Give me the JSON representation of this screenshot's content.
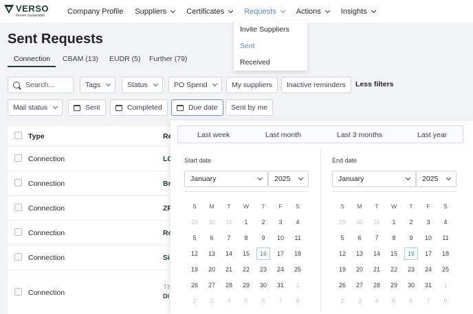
{
  "brand": {
    "name": "VERSO",
    "tagline": "forever sustainabili"
  },
  "nav": [
    {
      "label": "Company Profile",
      "chevron": false,
      "active": false,
      "name": "nav-company-profile"
    },
    {
      "label": "Suppliers",
      "chevron": true,
      "active": false,
      "name": "nav-suppliers"
    },
    {
      "label": "Certificates",
      "chevron": true,
      "active": false,
      "name": "nav-certificates"
    },
    {
      "label": "Requests",
      "chevron": true,
      "active": true,
      "name": "nav-requests"
    },
    {
      "label": "Actions",
      "chevron": true,
      "active": false,
      "name": "nav-actions"
    },
    {
      "label": "Insights",
      "chevron": true,
      "active": false,
      "name": "nav-insights"
    }
  ],
  "requests_menu": [
    {
      "label": "Invite Suppliers",
      "active": false
    },
    {
      "label": "Sent",
      "active": true
    },
    {
      "label": "Received",
      "active": false
    }
  ],
  "page": {
    "title": "Sent Requests"
  },
  "tabs": [
    {
      "label": "Connection",
      "active": true
    },
    {
      "label": "CBAM (13)",
      "active": false
    },
    {
      "label": "EUDR (5)",
      "active": false
    },
    {
      "label": "Further (79)",
      "active": false
    }
  ],
  "filters": {
    "search_placeholder": "Search...",
    "tags": "Tags",
    "status": "Status",
    "po_spend": "PO Spend",
    "my_suppliers": "My suppliers",
    "inactive_reminders": "Inactive reminders",
    "less_filters": "Less filters",
    "mail_status": "Mail status",
    "sent": "Sent",
    "completed": "Completed",
    "due_date": "Due date",
    "sent_by_me": "Sent by me"
  },
  "table": {
    "col_type": "Type",
    "col_recipient": "Re",
    "rows": [
      {
        "type": "Connection",
        "name": "LG"
      },
      {
        "type": "Connection",
        "name": "Br"
      },
      {
        "type": "Connection",
        "name": "ZF"
      },
      {
        "type": "Connection",
        "name": "Ro"
      },
      {
        "type": "Connection",
        "name": "Si"
      },
      {
        "type": "Connection",
        "name": "Th",
        "sub": "Di"
      }
    ]
  },
  "date_picker": {
    "presets": [
      "Last week",
      "Last month",
      "Last 3 months",
      "Last year"
    ],
    "weekdays": [
      "S",
      "M",
      "T",
      "W",
      "T",
      "F",
      "S"
    ],
    "start": {
      "label": "Start date",
      "month": "January",
      "year": "2025"
    },
    "end": {
      "label": "End date",
      "month": "January",
      "year": "2025"
    },
    "weeks": [
      [
        "29",
        "30",
        "31",
        "1",
        "2",
        "3",
        "4"
      ],
      [
        "5",
        "6",
        "7",
        "8",
        "9",
        "10",
        "11"
      ],
      [
        "12",
        "13",
        "14",
        "15",
        "16",
        "17",
        "18"
      ],
      [
        "19",
        "20",
        "21",
        "22",
        "23",
        "24",
        "25"
      ],
      [
        "26",
        "27",
        "28",
        "29",
        "30",
        "31",
        "1"
      ],
      [
        "2",
        "3",
        "4",
        "5",
        "6",
        "7",
        "8"
      ]
    ],
    "today": "16"
  },
  "colors": {
    "brand": "#1e3e33",
    "accent": "#5b86c8",
    "today": "#3f8f8a"
  }
}
